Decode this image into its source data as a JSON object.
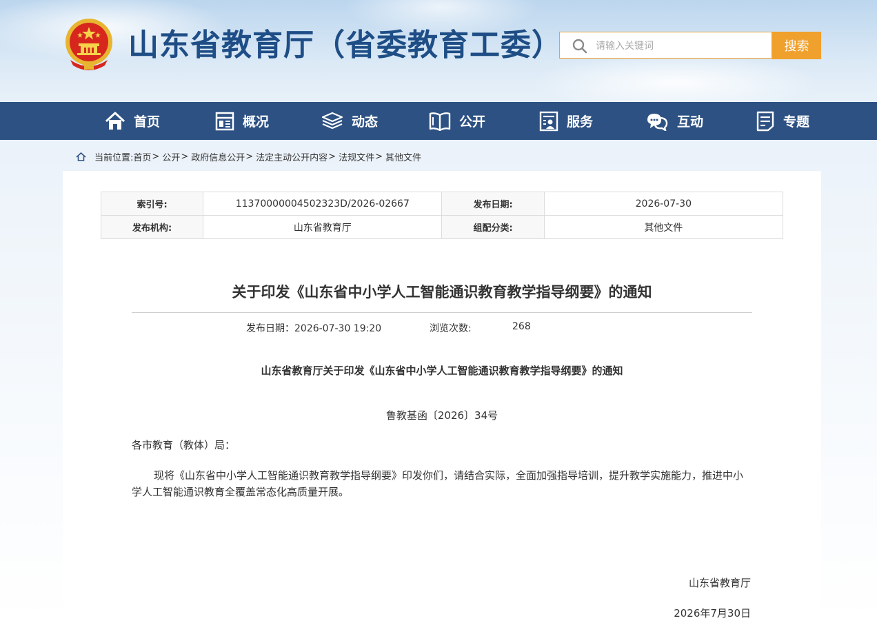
{
  "header": {
    "site_title": "山东省教育厅（省委教育工委）",
    "emblem_icon": "national-emblem-icon"
  },
  "search": {
    "placeholder": "请输入关键词",
    "button_label": "搜索"
  },
  "nav": {
    "items": [
      {
        "label": "首页",
        "icon": "home-icon"
      },
      {
        "label": "概况",
        "icon": "overview-icon"
      },
      {
        "label": "动态",
        "icon": "news-icon"
      },
      {
        "label": "公开",
        "icon": "open-book-icon"
      },
      {
        "label": "服务",
        "icon": "service-icon"
      },
      {
        "label": "互动",
        "icon": "chat-icon"
      },
      {
        "label": "专题",
        "icon": "topic-icon"
      }
    ]
  },
  "breadcrumb": {
    "prefix": "当前位置:",
    "items": [
      "首页",
      "公开",
      "政府信息公开",
      "法定主动公开内容",
      "法规文件",
      "其他文件"
    ],
    "separator": ">"
  },
  "meta": {
    "index_label": "索引号:",
    "index_value": "11370000004502323D/2026-02667",
    "pubdate_label": "发布日期:",
    "pubdate_value": "2026-07-30",
    "org_label": "发布机构:",
    "org_value": "山东省教育厅",
    "category_label": "组配分类:",
    "category_value": "其他文件"
  },
  "article": {
    "title": "关于印发《山东省中小学人工智能通识教育教学指导纲要》的通知",
    "pubdate_label": "发布日期：",
    "pubdate_value": "2026-07-30 19:20",
    "views_label": "浏览次数:",
    "views_value": "268",
    "doc_heading": "山东省教育厅关于印发《山东省中小学人工智能通识教育教学指导纲要》的通知",
    "doc_number": "鲁教基函〔2026〕34号",
    "salutation": "各市教育（教体）局：",
    "body": "现将《山东省中小学人工智能通识教育教学指导纲要》印发你们，请结合实际，全面加强指导培训，提升教学实施能力，推进中小学人工智能通识教育全覆盖常态化高质量开展。",
    "sign_org": "山东省教育厅",
    "sign_date": "2026年7月30日"
  },
  "colors": {
    "nav_bg": "#2d5183",
    "title_blue": "#1f4e86",
    "search_accent": "#f0a02c"
  }
}
